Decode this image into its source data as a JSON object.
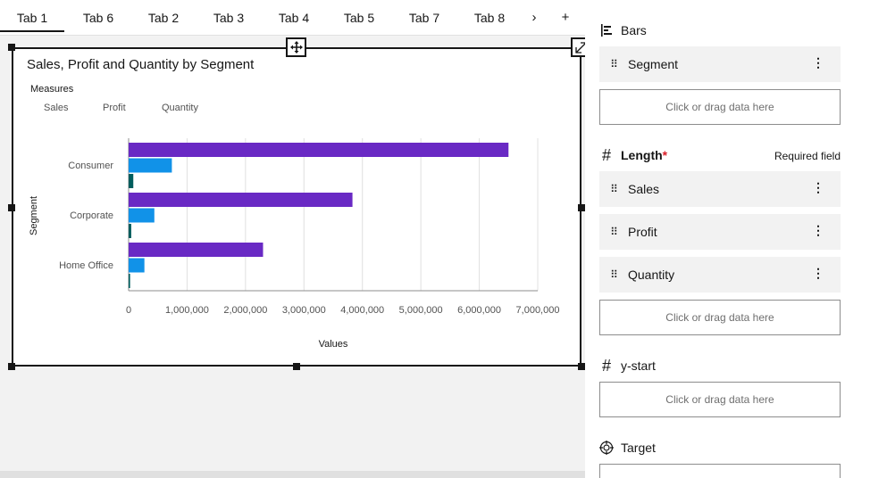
{
  "tabs": [
    {
      "label": "Tab 1",
      "active": true
    },
    {
      "label": "Tab 6"
    },
    {
      "label": "Tab 2"
    },
    {
      "label": "Tab 3"
    },
    {
      "label": "Tab 4"
    },
    {
      "label": "Tab 5"
    },
    {
      "label": "Tab 7"
    },
    {
      "label": "Tab 8"
    }
  ],
  "tab_next_glyph": "›",
  "tab_add_glyph": "+",
  "chart": {
    "title": "Sales, Profit and Quantity by Segment",
    "legend_title": "Measures",
    "legend_items": [
      "Sales",
      "Profit",
      "Quantity"
    ],
    "ylabel": "Segment",
    "xlabel": "Values"
  },
  "chart_data": {
    "type": "bar",
    "orientation": "horizontal",
    "title": "Sales, Profit and Quantity by Segment",
    "xlabel": "Values",
    "ylabel": "Segment",
    "categories": [
      "Consumer",
      "Corporate",
      "Home Office"
    ],
    "series": [
      {
        "name": "Sales",
        "color": "#6929c4",
        "values": [
          6500000,
          3830000,
          2300000
        ]
      },
      {
        "name": "Profit",
        "color": "#1192e8",
        "values": [
          740000,
          440000,
          270000
        ]
      },
      {
        "name": "Quantity",
        "color": "#005d5d",
        "values": [
          80000,
          45000,
          25000
        ]
      }
    ],
    "xlim": [
      0,
      7000000
    ],
    "x_ticks": [
      "0",
      "1,000,000",
      "2,000,000",
      "3,000,000",
      "4,000,000",
      "5,000,000",
      "6,000,000",
      "7,000,000"
    ],
    "grid": true,
    "legend_position": "top-left"
  },
  "panel": {
    "bars": {
      "label": "Bars",
      "field": "Segment",
      "drop_text": "Click or drag data here"
    },
    "length": {
      "label": "Length",
      "required_mark": "*",
      "required_text": "Required field",
      "fields": [
        "Sales",
        "Profit",
        "Quantity"
      ],
      "drop_text": "Click or drag data here"
    },
    "ystart": {
      "label": "y-start",
      "drop_text": "Click or drag data here"
    },
    "target": {
      "label": "Target"
    }
  },
  "colors": {
    "accent": "#6929c4",
    "required": "#da1e28"
  }
}
